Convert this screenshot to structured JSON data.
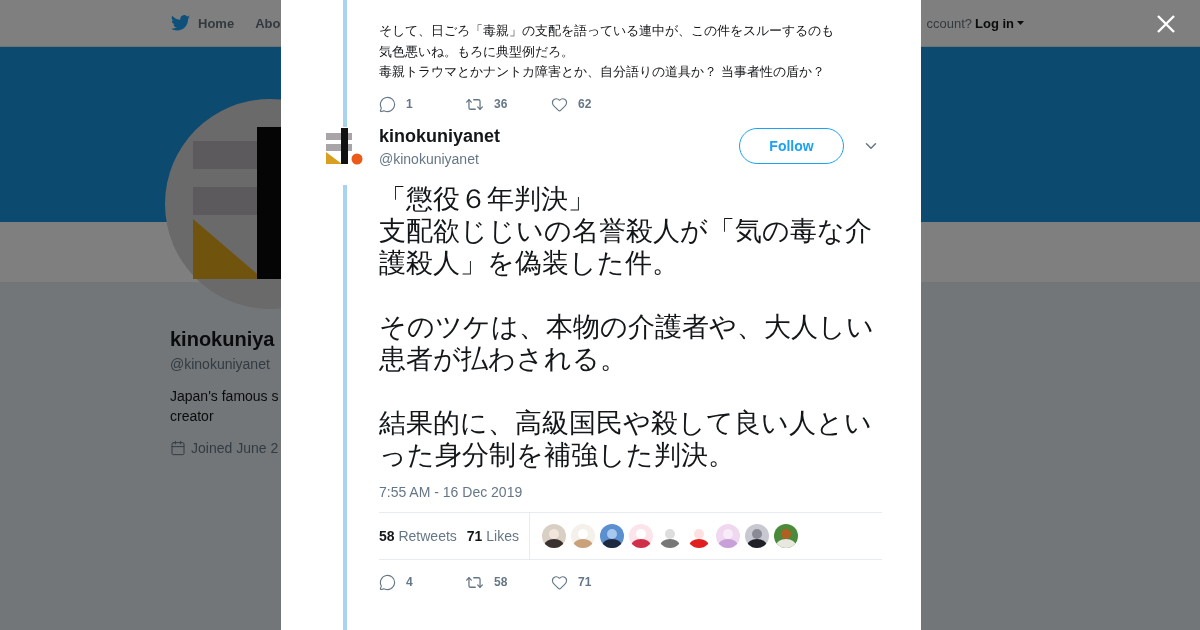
{
  "backdrop": {
    "nav": {
      "home": "Home",
      "about": "Abo",
      "account_prompt": "ccount?",
      "login": "Log in"
    },
    "profile": {
      "name": "kinokuniya",
      "handle": "@kinokuniyanet",
      "bio": [
        "Japan's famous s",
        "creator"
      ],
      "joined": "Joined June 2"
    }
  },
  "modal": {
    "previous_tweet": {
      "lines": [
        "そして、日ごろ「毒親」の支配を語っている連中が、この件をスルーするのも",
        "気色悪いね。もろに典型例だろ。",
        "毒親トラウマとかナントカ障害とか、自分語りの道具か？ 当事者性の盾か？"
      ],
      "actions": [
        {
          "kind": "reply",
          "count": "1"
        },
        {
          "kind": "retweet",
          "count": "36"
        },
        {
          "kind": "like",
          "count": "62"
        }
      ]
    },
    "tweet": {
      "name": "kinokuniyanet",
      "handle": "@kinokuniyanet",
      "follow": "Follow",
      "paragraphs": [
        [
          "「懲役６年判決」",
          "支配欲じじいの名誉殺人が「気の毒な介護殺人」を偽装した件。"
        ],
        [
          "そのツケは、本物の介護者や、大人しい患者が払わされる。"
        ],
        [
          "結果的に、高級国民や殺して良い人といった身分制を補強した判決。"
        ]
      ],
      "timestamp": "7:55 AM - 16 Dec 2019",
      "stats": [
        {
          "count": "58",
          "label": "Retweets"
        },
        {
          "count": "71",
          "label": "Likes"
        }
      ],
      "liker_avatars": [
        {
          "kind": "picture"
        },
        {
          "kind": "picture"
        },
        {
          "kind": "picture"
        },
        {
          "kind": "picture"
        },
        {
          "kind": "picture"
        },
        {
          "kind": "picture"
        },
        {
          "kind": "picture"
        },
        {
          "kind": "picture"
        },
        {
          "kind": "picture"
        }
      ],
      "actions": [
        {
          "kind": "reply",
          "count": "4"
        },
        {
          "kind": "retweet",
          "count": "58"
        },
        {
          "kind": "like",
          "count": "71"
        }
      ]
    }
  }
}
